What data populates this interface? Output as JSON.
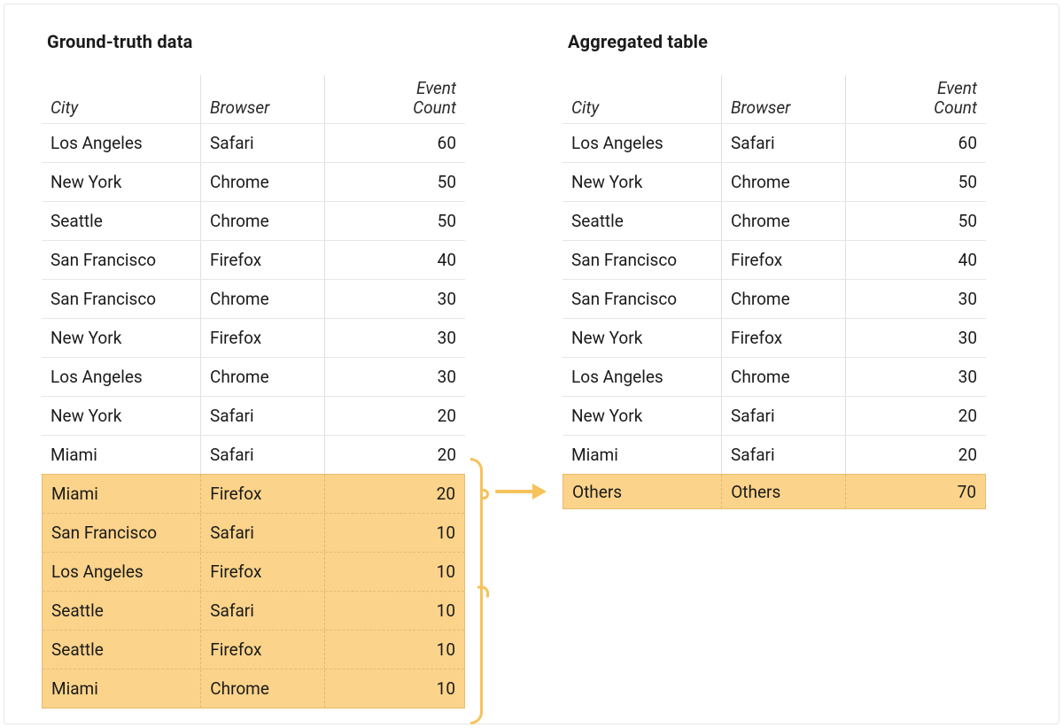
{
  "left": {
    "title": "Ground-truth data",
    "columns": {
      "city": "City",
      "browser": "Browser",
      "count_l1": "Event",
      "count_l2": "Count"
    },
    "rows": [
      {
        "city": "Los Angeles",
        "browser": "Safari",
        "count": 60,
        "hi": false
      },
      {
        "city": "New York",
        "browser": "Chrome",
        "count": 50,
        "hi": false
      },
      {
        "city": "Seattle",
        "browser": "Chrome",
        "count": 50,
        "hi": false
      },
      {
        "city": "San Francisco",
        "browser": "Firefox",
        "count": 40,
        "hi": false
      },
      {
        "city": "San Francisco",
        "browser": "Chrome",
        "count": 30,
        "hi": false
      },
      {
        "city": "New York",
        "browser": "Firefox",
        "count": 30,
        "hi": false
      },
      {
        "city": "Los Angeles",
        "browser": "Chrome",
        "count": 30,
        "hi": false
      },
      {
        "city": "New York",
        "browser": "Safari",
        "count": 20,
        "hi": false
      },
      {
        "city": "Miami",
        "browser": "Safari",
        "count": 20,
        "hi": false
      },
      {
        "city": "Miami",
        "browser": "Firefox",
        "count": 20,
        "hi": true
      },
      {
        "city": "San Francisco",
        "browser": "Safari",
        "count": 10,
        "hi": true
      },
      {
        "city": "Los Angeles",
        "browser": "Firefox",
        "count": 10,
        "hi": true
      },
      {
        "city": "Seattle",
        "browser": "Safari",
        "count": 10,
        "hi": true
      },
      {
        "city": "Seattle",
        "browser": "Firefox",
        "count": 10,
        "hi": true
      },
      {
        "city": "Miami",
        "browser": "Chrome",
        "count": 10,
        "hi": true
      }
    ]
  },
  "right": {
    "title": "Aggregated table",
    "columns": {
      "city": "City",
      "browser": "Browser",
      "count_l1": "Event",
      "count_l2": "Count"
    },
    "rows": [
      {
        "city": "Los Angeles",
        "browser": "Safari",
        "count": 60,
        "hi": false
      },
      {
        "city": "New York",
        "browser": "Chrome",
        "count": 50,
        "hi": false
      },
      {
        "city": "Seattle",
        "browser": "Chrome",
        "count": 50,
        "hi": false
      },
      {
        "city": "San Francisco",
        "browser": "Firefox",
        "count": 40,
        "hi": false
      },
      {
        "city": "San Francisco",
        "browser": "Chrome",
        "count": 30,
        "hi": false
      },
      {
        "city": "New York",
        "browser": "Firefox",
        "count": 30,
        "hi": false
      },
      {
        "city": "Los Angeles",
        "browser": "Chrome",
        "count": 30,
        "hi": false
      },
      {
        "city": "New York",
        "browser": "Safari",
        "count": 20,
        "hi": false
      },
      {
        "city": "Miami",
        "browser": "Safari",
        "count": 20,
        "hi": false
      },
      {
        "city": "Others",
        "browser": "Others",
        "count": 70,
        "hi": true
      }
    ]
  },
  "colors": {
    "highlight": "#fbd38a",
    "arrow": "#f6c25b"
  }
}
